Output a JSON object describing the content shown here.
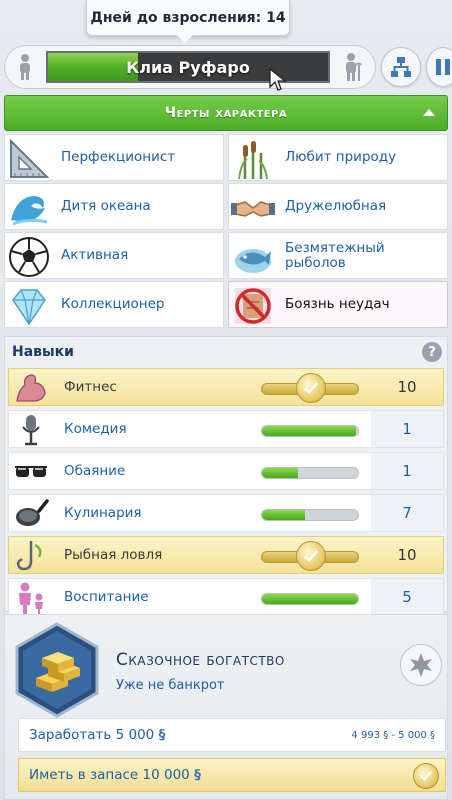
{
  "tooltip": {
    "text": "Дней до взросления: 14"
  },
  "header": {
    "sim_name": "Клиа Руфаро",
    "age_progress": 0.32,
    "buttons": [
      "family-tree-icon",
      "pause-icon"
    ]
  },
  "traits": {
    "title": "Черты характера",
    "items": [
      {
        "label": "Перфекционист",
        "icon": "ruler-triangle-icon"
      },
      {
        "label": "Любит природу",
        "icon": "cattails-icon"
      },
      {
        "label": "Дитя океана",
        "icon": "wave-icon"
      },
      {
        "label": "Дружелюбная",
        "icon": "handshake-icon"
      },
      {
        "label": "Активная",
        "icon": "soccer-ball-icon"
      },
      {
        "label": "Безмятежный рыболов",
        "icon": "fish-icon"
      },
      {
        "label": "Коллекционер",
        "icon": "crystal-icon"
      },
      {
        "label": "Боязнь неудач",
        "icon": "no-fail-icon"
      }
    ]
  },
  "skills": {
    "title": "Навыки",
    "help": "?",
    "items": [
      {
        "label": "Фитнес",
        "value": "10",
        "progress": 1.0,
        "maxed": true,
        "icon": "flexed-arm-icon"
      },
      {
        "label": "Комедия",
        "value": "1",
        "progress": 0.98,
        "maxed": false,
        "icon": "microphone-icon"
      },
      {
        "label": "Обаяние",
        "value": "1",
        "progress": 0.38,
        "maxed": false,
        "icon": "sunglasses-icon"
      },
      {
        "label": "Кулинария",
        "value": "7",
        "progress": 0.45,
        "maxed": false,
        "icon": "frying-pan-icon"
      },
      {
        "label": "Рыбная ловля",
        "value": "10",
        "progress": 1.0,
        "maxed": true,
        "icon": "fishing-hook-icon"
      },
      {
        "label": "Воспитание",
        "value": "5",
        "progress": 1.0,
        "maxed": false,
        "icon": "parenting-icon"
      }
    ]
  },
  "aspiration": {
    "title": "Сказочное богатство",
    "subtitle": "Уже не банкрот",
    "icon": "gold-bars-icon",
    "goals": [
      {
        "label": "Заработать 5 000",
        "currency": "§",
        "progress_text": "4 993 § - 5 000 §",
        "done": false
      },
      {
        "label": "Иметь в запасе 10 000",
        "currency": "§",
        "done": true
      }
    ]
  },
  "colors": {
    "accent": "#4cae2a",
    "link": "#1f5fa8",
    "gold": "#f3e29a"
  }
}
